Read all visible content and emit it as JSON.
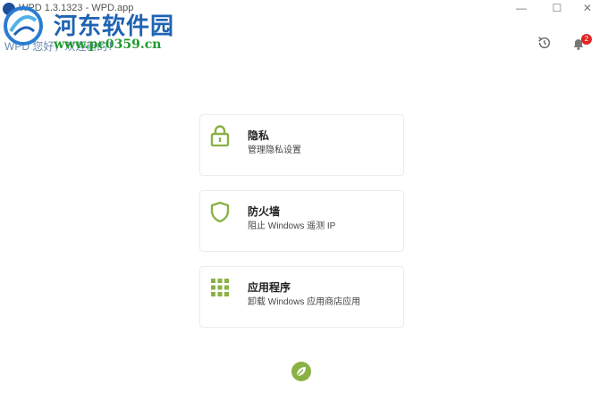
{
  "window": {
    "title": "WPD 1.3.1323 - WPD.app",
    "minimize": "—",
    "maximize": "☐",
    "close": "✕"
  },
  "watermark": {
    "title": "河东软件园",
    "url": "www.pc0359.cn"
  },
  "header": {
    "subtitle": "WPD 您好，欢迎新的！"
  },
  "toolbar": {
    "history_icon": "history-icon",
    "notifications_icon": "bell-icon",
    "notification_count": "2"
  },
  "cards": [
    {
      "icon": "lock-icon",
      "title": "隐私",
      "description": "管理隐私设置"
    },
    {
      "icon": "shield-icon",
      "title": "防火墙",
      "description": "阻止 Windows 遥测 IP"
    },
    {
      "icon": "apps-grid-icon",
      "title": "应用程序",
      "description": "卸载 Windows 应用商店应用"
    }
  ],
  "footer": {
    "icon": "leaf-icon"
  },
  "colors": {
    "accent": "#8bb146",
    "badge": "#e02424"
  }
}
